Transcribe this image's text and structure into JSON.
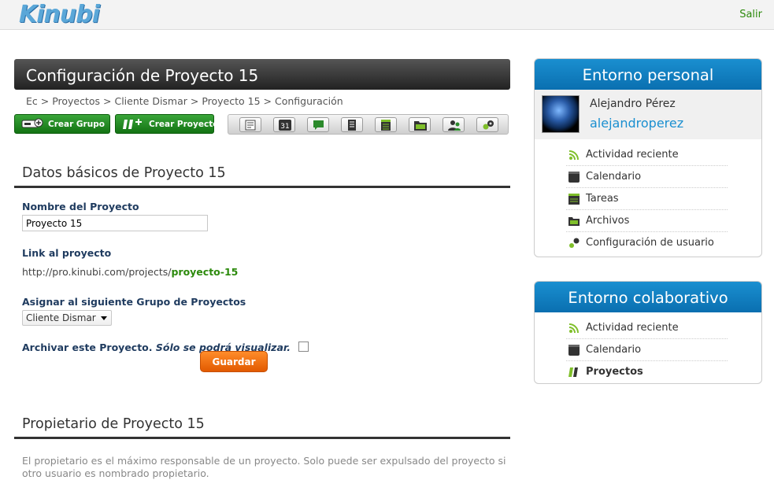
{
  "header": {
    "logo": "Kinubi",
    "logout": "Salir"
  },
  "page": {
    "title": "Configuración de Proyecto 15",
    "breadcrumb": "Ec > Proyectos > Cliente Dismar > Proyecto 15 > Configuración",
    "buttons": {
      "create_group": "Crear Grupo",
      "create_project": "Crear Proyecto"
    },
    "toolbar_icons": [
      "overview-icon",
      "calendar-icon",
      "messages-icon",
      "notes-icon",
      "tasks-icon",
      "files-icon",
      "users-icon",
      "settings-icon"
    ],
    "toolbar_calendar_day": "31"
  },
  "basic": {
    "heading": "Datos básicos de Proyecto 15",
    "name_label": "Nombre del Proyecto",
    "name_value": "Proyecto 15",
    "link_label": "Link al proyecto",
    "link_prefix": "http://pro.kinubi.com/projects/",
    "link_slug": "proyecto-15",
    "group_label": "Asignar al siguiente Grupo de Proyectos",
    "group_selected": "Cliente Dismar",
    "archive_label": "Archivar este Proyecto.",
    "archive_note": "Sólo se podrá visualizar.",
    "save_button": "Guardar"
  },
  "owner": {
    "heading": "Propietario de Proyecto 15",
    "description": "El propietario es el máximo responsable de un proyecto. Solo puede ser expulsado del proyecto si otro usuario es nombrado propietario."
  },
  "personal": {
    "title": "Entorno personal",
    "user_name": "Alejandro Pérez",
    "username": "alejandroperez",
    "items": [
      {
        "label": "Actividad reciente",
        "icon": "rss-icon"
      },
      {
        "label": "Calendario",
        "icon": "calendar-icon"
      },
      {
        "label": "Tareas",
        "icon": "tasks-icon"
      },
      {
        "label": "Archivos",
        "icon": "folder-icon"
      },
      {
        "label": "Configuración de usuario",
        "icon": "settings-icon"
      }
    ]
  },
  "collab": {
    "title": "Entorno colaborativo",
    "items": [
      {
        "label": "Actividad reciente",
        "icon": "rss-icon"
      },
      {
        "label": "Calendario",
        "icon": "calendar-icon"
      },
      {
        "label": "Proyectos",
        "icon": "projects-icon",
        "active": true
      }
    ]
  },
  "colors": {
    "accent_blue": "#1a8fd0",
    "green": "#2c8a0c",
    "orange": "#f07010"
  }
}
